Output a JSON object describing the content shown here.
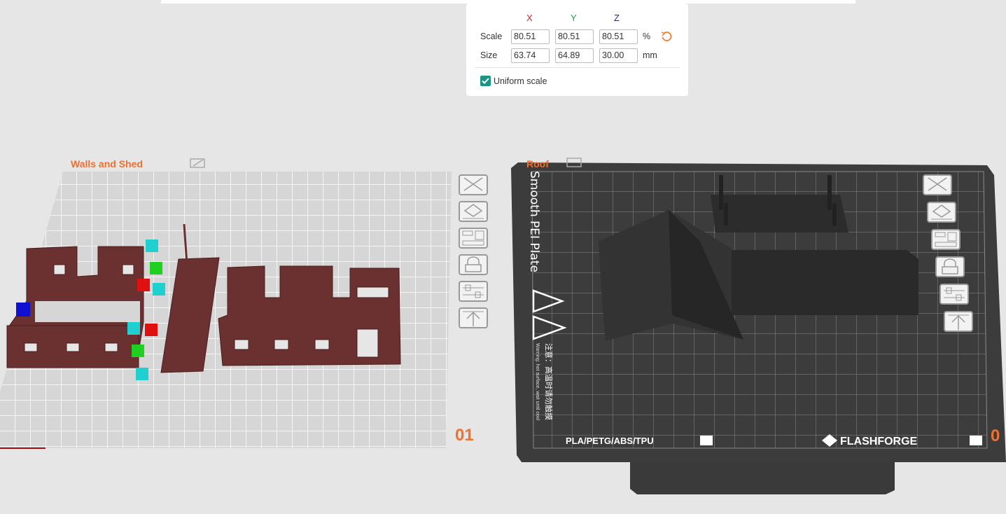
{
  "transform_panel": {
    "axes": {
      "x": "X",
      "y": "Y",
      "z": "Z"
    },
    "axis_colors": {
      "x": "#e02020",
      "y": "#20a040",
      "z": "#2020d0"
    },
    "scale": {
      "label": "Scale",
      "x": "80.51",
      "y": "80.51",
      "z": "80.51",
      "unit": "%"
    },
    "size": {
      "label": "Size",
      "x": "63.74",
      "y": "64.89",
      "z": "30.00",
      "unit": "mm"
    },
    "reset_icon": "rotate-ccw-icon",
    "uniform_scale": {
      "label": "Uniform scale",
      "checked": true
    }
  },
  "plates": [
    {
      "name": "Walls and Shed",
      "number": "01"
    },
    {
      "name": "Roof",
      "number": "0",
      "bed_label": "Smooth PEI Plate",
      "materials": "PLA/PETG/ABS/TPU",
      "brand": "FLASHFORGE",
      "warning_cn": "注意：高温时请勿触摸",
      "warning_en": "Warning: hot surface, wait until cool"
    }
  ],
  "plate_tools": [
    "close-icon",
    "auto-orient-icon",
    "arrange-icon",
    "lock-icon",
    "settings-sliders-icon",
    "move-to-top-icon"
  ],
  "colors": {
    "accent": "#f07030",
    "model": "#6b3030",
    "model_dark": "#333333",
    "bed": "#3c3c3c"
  }
}
